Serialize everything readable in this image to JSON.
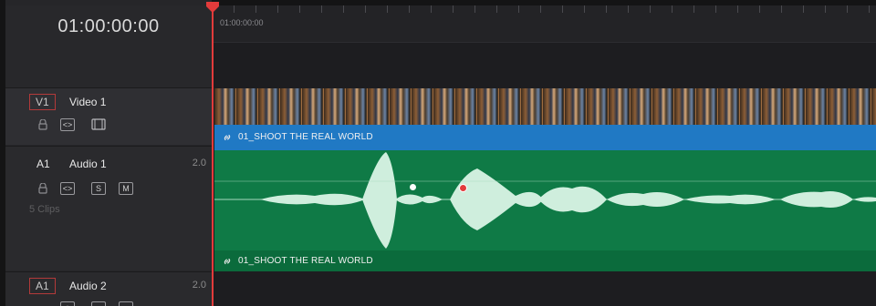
{
  "timecode": "01:00:00:00",
  "ruler": {
    "start_label": "01:00:00:00"
  },
  "tracks": {
    "video1": {
      "id": "V1",
      "name": "Video 1"
    },
    "audio1": {
      "id": "A1",
      "name": "Audio 1",
      "volume": "2.0",
      "clip_count": "5 Clips",
      "solo": "S",
      "mute": "M"
    },
    "audio2": {
      "id": "A1",
      "name": "Audio 2",
      "volume": "2.0"
    }
  },
  "clips": {
    "video_title": "01_SHOOT THE REAL WORLD",
    "audio_title": "01_SHOOT THE REAL WORLD"
  },
  "colors": {
    "playhead": "#e23b3b",
    "video_clip": "#2079c4",
    "audio_clip": "#0f7a46",
    "waveform": "#cfeedd"
  },
  "icons": [
    "lock-icon",
    "auto-select-icon",
    "film-clip-icon",
    "link-icon"
  ]
}
